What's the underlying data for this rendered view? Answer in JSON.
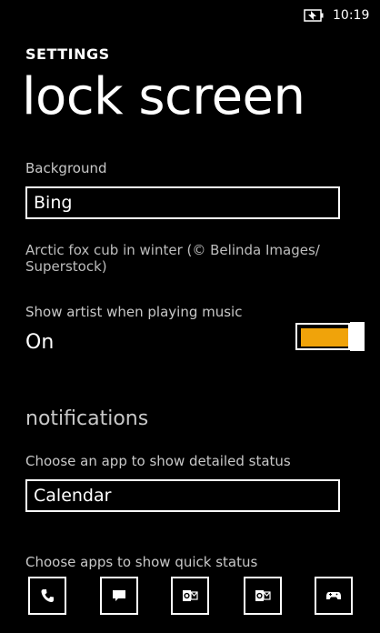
{
  "status_bar": {
    "time": "10:19",
    "battery_icon": "battery-charging-icon"
  },
  "header": {
    "app_title": "SETTINGS",
    "page_title": "lock screen"
  },
  "background": {
    "label": "Background",
    "value": "Bing",
    "description": "Arctic fox cub in winter (© Belinda Images/ Superstock)"
  },
  "show_artist": {
    "label": "Show artist when playing music",
    "value": "On",
    "enabled": true,
    "accent_color": "#f0a30a"
  },
  "notifications": {
    "header": "notifications",
    "detailed_label": "Choose an app to show detailed status",
    "detailed_value": "Calendar",
    "quick_label": "Choose apps to show quick status",
    "quick_apps": [
      {
        "icon": "phone-icon"
      },
      {
        "icon": "messaging-icon"
      },
      {
        "icon": "outlook-mail-icon"
      },
      {
        "icon": "outlook-mail-icon"
      },
      {
        "icon": "game-controller-icon"
      }
    ]
  }
}
